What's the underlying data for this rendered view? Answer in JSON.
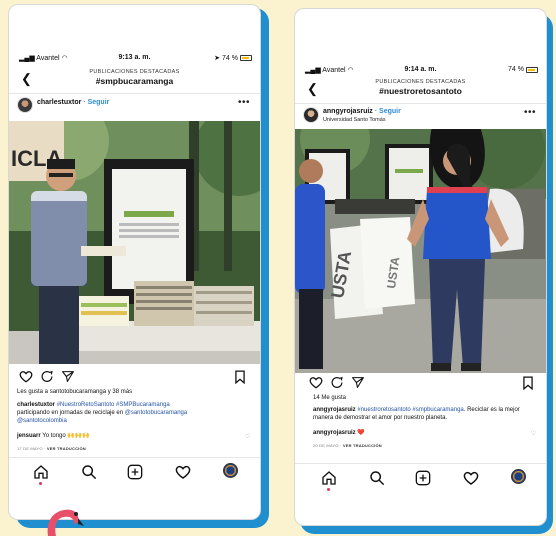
{
  "phone1": {
    "status": {
      "carrier": "Avantel",
      "time": "9:13 a. m.",
      "battery": "74 %"
    },
    "header": {
      "subtitle": "PUBLICACIONES DESTACADAS",
      "hashtag": "#smpbucaramanga"
    },
    "user": {
      "name": "charlestuxtor",
      "follow": "· Seguir",
      "more": "•••"
    },
    "photo": {
      "banner_text": "ICLA"
    },
    "likes": "Les gusta a santotobucaramanga y 38 más",
    "caption": {
      "user": "charlestuxtor",
      "hashtags": "#NuestroRetoSantoto #SMPBucaramanga",
      "text": "participando en jornadas de reciclaje en",
      "mention1": "@santotobucaramanga",
      "mention2": "@santotocolombia"
    },
    "comment": {
      "user": "jensuarr",
      "text": "Yo tongo",
      "emoji": "🙌🙌🙌"
    },
    "meta": {
      "date": "17 DE MAYO",
      "sep": " · ",
      "translate": "VER TRADUCCIÓN"
    }
  },
  "phone2": {
    "status": {
      "carrier": "Avantel",
      "time": "9:14 a. m.",
      "battery": "74 %"
    },
    "header": {
      "subtitle": "PUBLICACIONES DESTACADAS",
      "hashtag": "#nuestroretosantoto"
    },
    "user": {
      "name": "anngyrojasruiz",
      "follow": "· Seguir",
      "location": "Universidad Santo Tomás",
      "more": "•••"
    },
    "photo": {
      "bag_text_1": "USTA",
      "bag_text_2": "USTA"
    },
    "likes": "14 Me gusta",
    "caption": {
      "user": "anngyrojasruiz",
      "hashtags": "#nuestroretosantoto #smpbucaramanga",
      "text": ". Reciclar es la mejor manera de demostrar el amor por nuestro planeta."
    },
    "comment": {
      "user": "anngyrojasruiz",
      "emoji": "❤️"
    },
    "meta": {
      "date": "20 DE MAYO",
      "sep": " · ",
      "translate": "VER TRADUCCIÓN"
    }
  },
  "colors": {
    "background": "#fbf3cf",
    "frame_blue": "#1f8fd0",
    "link": "#2e8bd6"
  },
  "icons": [
    "heart-icon",
    "comment-icon",
    "share-icon",
    "bookmark-icon",
    "home-icon",
    "search-icon",
    "add-icon",
    "activity-icon",
    "profile-icon"
  ]
}
